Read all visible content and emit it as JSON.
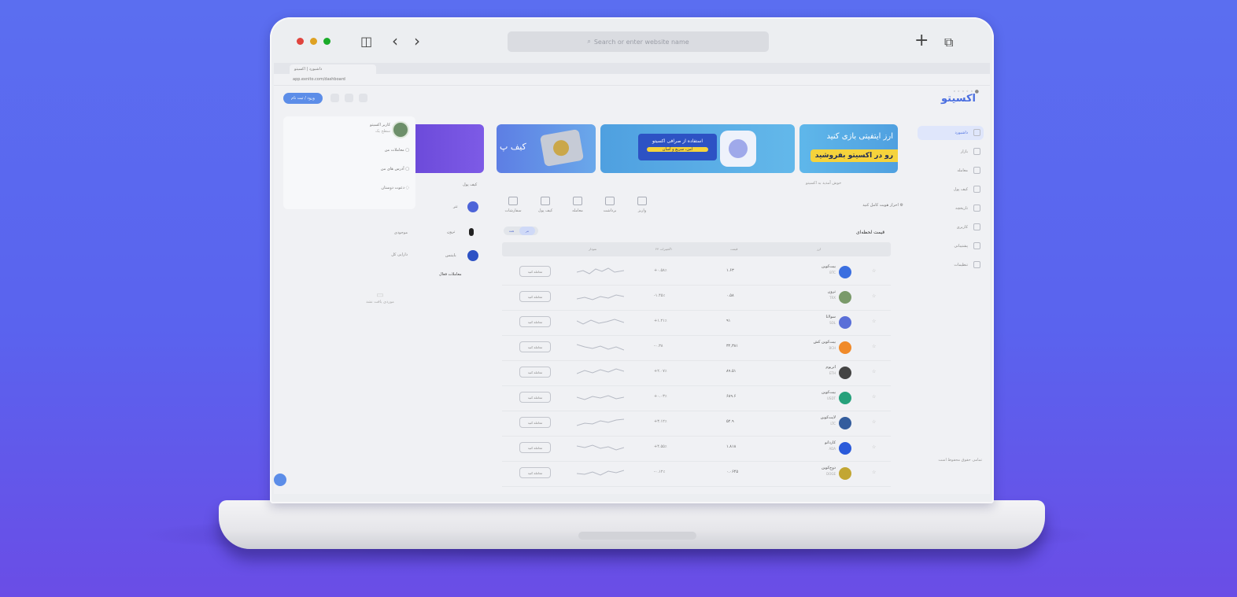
{
  "outer_bar": {
    "url_placeholder": "Search or enter website name",
    "sidebar_icon": "sidebar-icon",
    "back_icon": "chevron-left-icon",
    "forward_icon": "chevron-right-icon",
    "new_tab_icon": "plus-icon",
    "tabs_icon": "tabs-icon",
    "traffic_colors": [
      "#e0443e",
      "#dea123",
      "#1aab29"
    ]
  },
  "browser": {
    "tab_title": "داشبورد | اکسیتو",
    "address": "app.exnito.com/dashboard"
  },
  "app": {
    "logo": "اکسیتو",
    "login_label": "ورود / ثبت نام",
    "accent": "#4a6ee0"
  },
  "sidebar": {
    "items": [
      {
        "label": "داشبورد",
        "active": true
      },
      {
        "label": "بازار"
      },
      {
        "label": "معامله"
      },
      {
        "label": "کیف پول"
      },
      {
        "label": "تاریخچه"
      },
      {
        "label": "کاربری"
      },
      {
        "label": "پشتیبانی"
      },
      {
        "label": "تنظیمات"
      }
    ],
    "footer": "تمامی حقوق محفوظ است"
  },
  "banners": {
    "b1_line1": "ارز ایتفیتی بازی کنید",
    "b1_line2": "رو در اکسیتو بفروشید",
    "b2_line1": "استفاده از صرافی اکسیتو",
    "b2_line2": "امن، سریع و آسان",
    "b3_text": "کیف پ"
  },
  "breadcrumb": "خوش آمدید به اکسیتو",
  "actions": {
    "items": [
      "واریز",
      "برداشت",
      "معامله",
      "کیف پول",
      "سفارشات"
    ],
    "right_text": "احراز هویت کامل کنید"
  },
  "left_panel": {
    "user_name": "کاربر اکسیتو",
    "user_sub": "سطح یک",
    "rows": [
      "معاملات من",
      "آدرس های من",
      "دعوت دوستان"
    ],
    "wallet_rows": [
      "موجودی",
      "دارایی کل"
    ],
    "empty_text": "موردی یافت نشد"
  },
  "mid": {
    "title": "کیف پول",
    "coin_labels": [
      "تتر",
      "ترون",
      "بایننس"
    ],
    "recent_title": "معاملات فعال"
  },
  "table": {
    "title": "قیمت لحظه‌ای",
    "toggle": [
      "همه",
      "تتر"
    ],
    "headers": [
      "ارز",
      "قیمت",
      "تغییرات ۲۴h",
      "نمودار",
      ""
    ],
    "trade_label": "معامله کنید",
    "rows": [
      {
        "name": "بیت‌کوین",
        "sym": "BTC",
        "price": "۱.۶۳",
        "change": "+۰.۵۸٪",
        "color": "#3b6fe0"
      },
      {
        "name": "ترون",
        "sym": "TRX",
        "price": "۰.۵۸",
        "change": "-۱.۴۵٪",
        "color": "#7a9a6a"
      },
      {
        "name": "سولانا",
        "sym": "SOL",
        "price": "۹۱",
        "change": "+۱.۲۱٪",
        "color": "#5a6fd8"
      },
      {
        "name": "بیت‌کوین کش",
        "sym": "BCH",
        "price": "۳۲,۳۸۱",
        "change": "-۰.۳۸",
        "color": "#f08a2a"
      },
      {
        "name": "اتریوم",
        "sym": "ETH",
        "price": "۸۹.۵۱",
        "change": "+۲.۰۷٪",
        "color": "#444444"
      },
      {
        "name": "بیت‌کوین",
        "sym": "USDT",
        "price": "۶۸۹.۶",
        "change": "+۰.۰۳٪",
        "color": "#26a17b"
      },
      {
        "name": "لایت‌کوین",
        "sym": "LTC",
        "price": "۵۲.۹",
        "change": "+۳.۱۲٪",
        "color": "#345d9d"
      },
      {
        "name": "کاردانو",
        "sym": "ADA",
        "price": "۱.۸۱۸",
        "change": "+۴.۵۵٪",
        "color": "#2a5ada"
      },
      {
        "name": "دوج‌کوین",
        "sym": "DOGE",
        "price": "۰.۰۶۴۵",
        "change": "-۰.۱۲٪",
        "color": "#c2a633"
      }
    ]
  }
}
